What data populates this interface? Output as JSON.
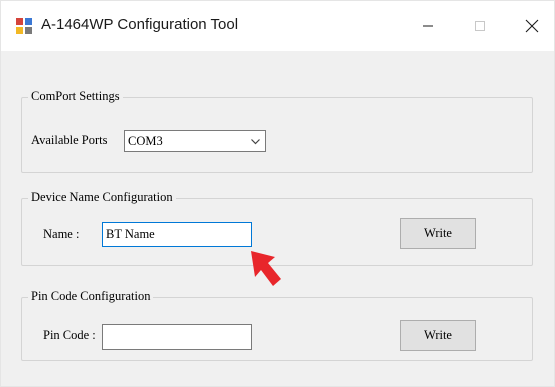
{
  "window": {
    "title": "A-1464WP Configuration Tool"
  },
  "controls": {
    "minimize_icon": "minimize-icon",
    "maximize_icon": "maximize-icon",
    "close_icon": "close-icon"
  },
  "comport": {
    "legend": "ComPort Settings",
    "ports_label": "Available Ports",
    "selected_port": "COM3"
  },
  "device_name": {
    "legend": "Device Name Configuration",
    "name_label": "Name :",
    "name_value": "BT Name",
    "write_label": "Write"
  },
  "pin_code": {
    "legend": "Pin Code Configuration",
    "pin_label": "Pin Code :",
    "pin_value": "",
    "write_label": "Write"
  },
  "colors": {
    "focus_border": "#0078d7",
    "annotation_arrow": "#e8262b"
  }
}
